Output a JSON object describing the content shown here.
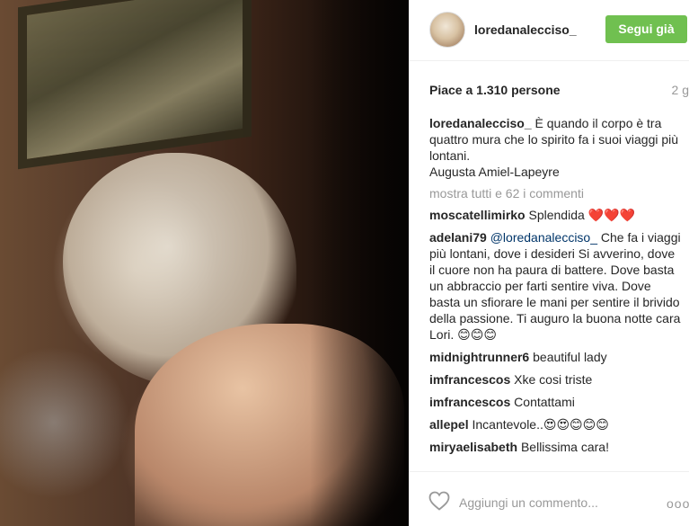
{
  "post": {
    "username": "loredanalecciso_",
    "follow_label": "Segui già",
    "likes_text": "Piace a 1.310 persone",
    "time_ago": "2 g",
    "caption": {
      "username": "loredanalecciso_",
      "text": "È quando il corpo è tra quattro mura che lo spirito fa i suoi viaggi più lontani.",
      "line2": "Augusta Amiel-Lapeyre"
    },
    "view_all_comments": "mostra tutti e 62 i commenti",
    "comments": [
      {
        "user": "moscatellimirko",
        "text": "Splendida ❤️❤️❤️"
      },
      {
        "user": "adelani79",
        "mention": "@loredanalecciso_",
        "text": "Che fa i viaggi più lontani, dove i desideri Si avverino, dove il cuore non ha paura di battere. Dove basta un abbraccio per farti sentire viva. Dove basta un sfiorare le mani per sentire il brivido della passione. Ti auguro la buona notte cara Lori. 😊😊😊"
      },
      {
        "user": "midnightrunner6",
        "text": "beautiful lady"
      },
      {
        "user": "imfrancescos",
        "text": "Xke cosi triste"
      },
      {
        "user": "imfrancescos",
        "text": "Contattami"
      },
      {
        "user": "allepel",
        "text": "Incantevole..😍😍😊😊😊"
      },
      {
        "user": "miryaelisabeth",
        "text": "Bellissima cara!"
      }
    ],
    "add_comment_placeholder": "Aggiungi un commento...",
    "more_options": "ooo"
  },
  "icons": {
    "like": "heart-outline-icon",
    "options": "more-options-icon"
  },
  "colors": {
    "follow_button": "#70c050",
    "mention": "#003569",
    "muted": "#999999",
    "heart_red": "#d0011b"
  }
}
